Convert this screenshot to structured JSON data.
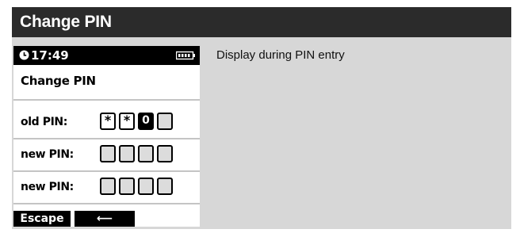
{
  "header": {
    "title": "Change PIN"
  },
  "caption": "Display during PIN entry",
  "device": {
    "status": {
      "time": "17:49",
      "clock_icon": "clock-icon",
      "battery_icon": "battery-icon"
    },
    "screen_title": "Change PIN",
    "rows": [
      {
        "label": "old PIN:",
        "digits": [
          "*",
          "*",
          "0",
          ""
        ],
        "active_index": 2
      },
      {
        "label": "new PIN:",
        "digits": [
          "",
          "",
          "",
          ""
        ]
      },
      {
        "label": "new PIN:",
        "digits": [
          "",
          "",
          "",
          ""
        ]
      }
    ],
    "softkeys": {
      "escape": "Escape",
      "back": "⟵",
      "back_icon": "left-arrow-icon"
    }
  }
}
